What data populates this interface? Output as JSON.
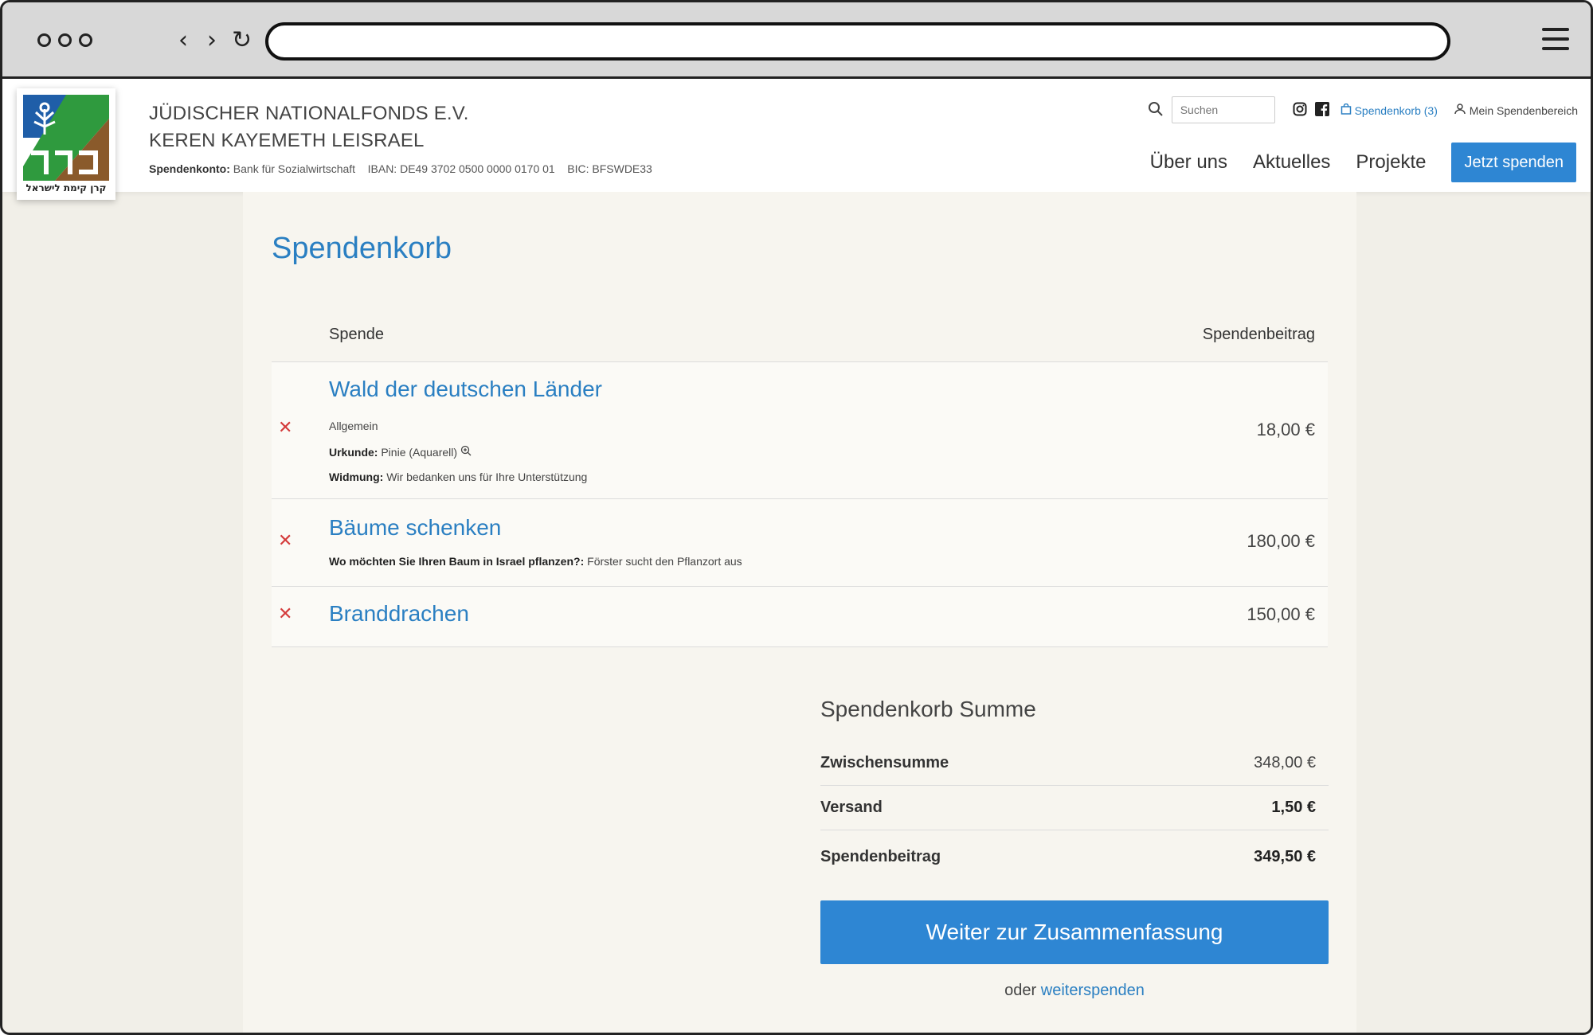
{
  "site": {
    "org_line1": "JÜDISCHER NATIONALFONDS E.V.",
    "org_line2": "KEREN KAYEMETH LEISRAEL",
    "logo_caption": "קרן קימת לישראל",
    "bank_label": "Spendenkonto:",
    "bank_text": "Bank für Sozialwirtschaft    IBAN: DE49 3702 0500 0000 0170 01    BIC: BFSWDE33"
  },
  "utility": {
    "search_placeholder": "Suchen",
    "cart_label": "Spendenkorb (3)",
    "account_label": "Mein Spendenbereich"
  },
  "nav": {
    "items": [
      "Über uns",
      "Aktuelles",
      "Projekte"
    ],
    "donate_label": "Jetzt spenden"
  },
  "page": {
    "title": "Spendenkorb",
    "col_spende": "Spende",
    "col_betrag": "Spendenbeitrag"
  },
  "items": [
    {
      "title": "Wald der deutschen Länder",
      "category": "Allgemein",
      "urkunde_label": "Urkunde:",
      "urkunde_value": "Pinie (Aquarell)",
      "widmung_label": "Widmung:",
      "widmung_value": "Wir bedanken uns für Ihre Unterstützung",
      "amount": "18,00 €"
    },
    {
      "title": "Bäume schenken",
      "question_label": "Wo möchten Sie Ihren Baum in Israel pflanzen?:",
      "question_value": "Förster sucht den Pflanzort aus",
      "amount": "180,00 €"
    },
    {
      "title": "Branddrachen",
      "amount": "150,00 €"
    }
  ],
  "remove_symbol": "✕",
  "summary": {
    "title": "Spendenkorb Summe",
    "subtotal_label": "Zwischensumme",
    "subtotal_value": "348,00 €",
    "shipping_label": "Versand",
    "shipping_value": "1,50 €",
    "total_label": "Spendenbeitrag",
    "total_value": "349,50 €",
    "continue_label": "Weiter zur Zusammenfassung",
    "or_text": "oder",
    "continue_shopping": "weiterspenden"
  },
  "colors": {
    "accent": "#2a7fc2",
    "button": "#2e86d3",
    "remove": "#d43a3a"
  }
}
